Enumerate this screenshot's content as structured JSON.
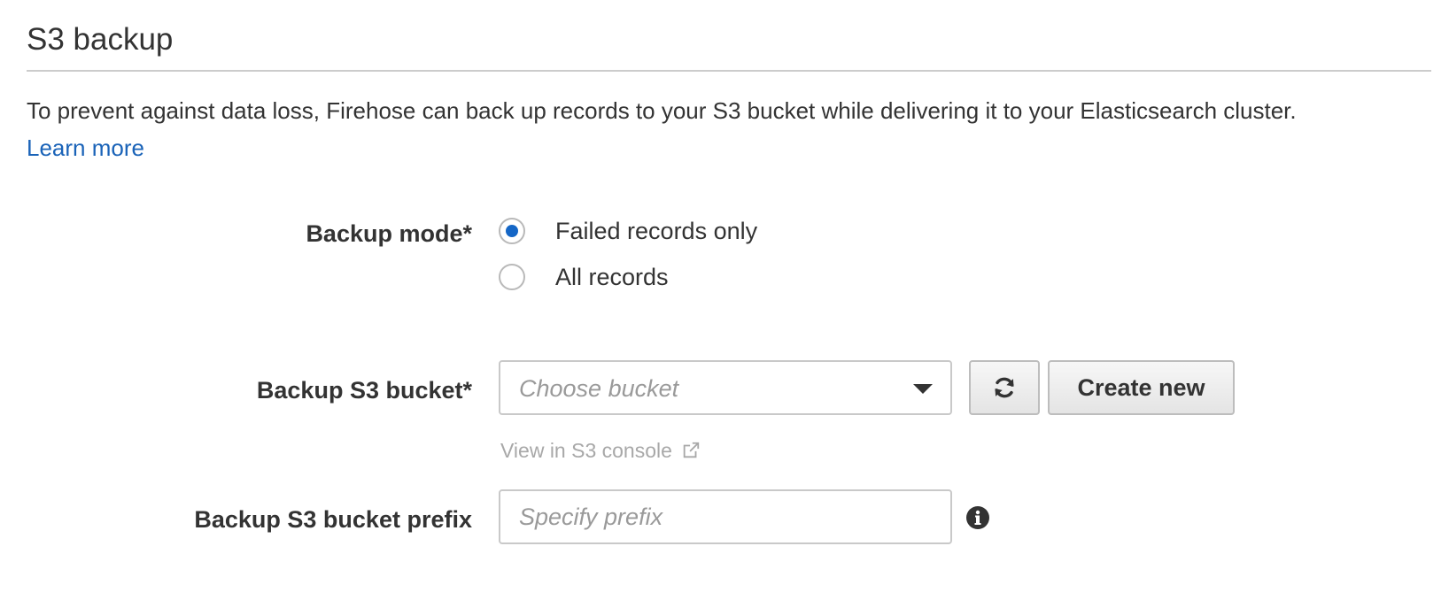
{
  "section": {
    "title": "S3 backup",
    "description": "To prevent against data loss, Firehose can back up records to your S3 bucket while delivering it to your Elasticsearch cluster.",
    "learn_more_label": "Learn more"
  },
  "backup_mode": {
    "label": "Backup mode*",
    "options": [
      {
        "label": "Failed records only",
        "selected": true
      },
      {
        "label": "All records",
        "selected": false
      }
    ]
  },
  "backup_bucket": {
    "label": "Backup S3 bucket*",
    "placeholder": "Choose bucket",
    "refresh_icon": "refresh-icon",
    "create_new_label": "Create new",
    "console_link_label": "View in S3 console",
    "console_link_icon": "external-link-icon"
  },
  "backup_prefix": {
    "label": "Backup S3 bucket prefix",
    "placeholder": "Specify prefix",
    "value": "",
    "info_icon": "info-icon"
  },
  "colors": {
    "link": "#1a63b8",
    "radio_selected": "#1466c6",
    "text": "#333333",
    "placeholder": "#9a9a9a"
  }
}
